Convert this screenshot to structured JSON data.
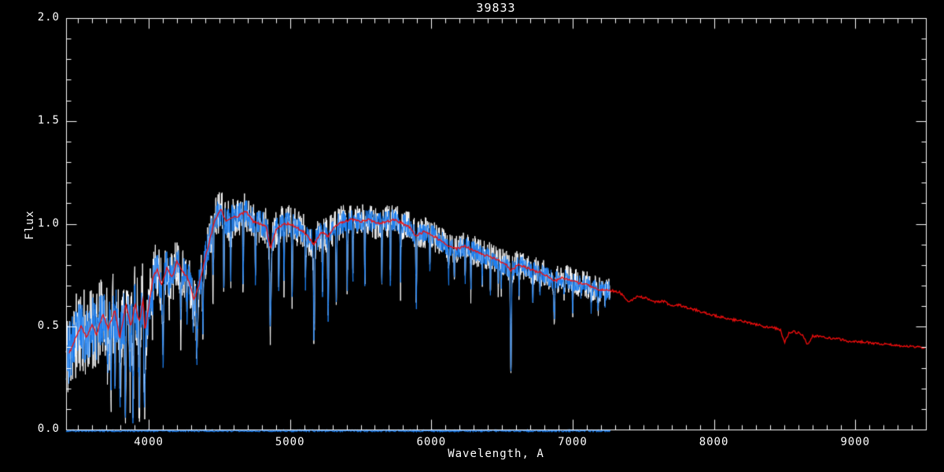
{
  "window": {
    "background": "#000000"
  },
  "chart_data": {
    "type": "line",
    "title": "39833",
    "xlabel": "Wavelength, A",
    "ylabel": "Flux",
    "xlim": [
      3415,
      9500
    ],
    "ylim": [
      0.0,
      2.0
    ],
    "grid": false,
    "legend": "none",
    "axis_color": "#FFFFFF",
    "background": "#000000",
    "x_ticks": [
      4000,
      5000,
      6000,
      7000,
      8000,
      9000
    ],
    "x_tick_labels": [
      "4000",
      "5000",
      "6000",
      "7000",
      "8000",
      "9000"
    ],
    "x_minor_step": 100,
    "y_ticks": [
      0.0,
      0.5,
      1.0,
      1.5,
      2.0
    ],
    "y_tick_labels": [
      "0.0",
      "0.5",
      "1.0",
      "1.5",
      "2.0"
    ],
    "y_minor_step": 0.1,
    "series": [
      {
        "name": "observed-spectrum",
        "color": "#FFFFFF",
        "kind": "noisy",
        "x_range": [
          3415,
          7265
        ],
        "step": 2.2,
        "noise_scale": 1.5,
        "line_depth_scale": 1.0,
        "seed": 11,
        "line_width": 1
      },
      {
        "name": "fitted-spectrum",
        "color": "#1D7FF0",
        "kind": "noisy",
        "x_range": [
          3415,
          7265
        ],
        "step": 2.2,
        "noise_scale": 1.0,
        "line_depth_scale": 1.0,
        "seed": 23,
        "line_width": 1
      },
      {
        "name": "template-spectrum",
        "color": "#F40D0D",
        "kind": "smooth",
        "x_range": [
          3437,
          9500
        ],
        "step": 6,
        "jitter": 0.006,
        "seed": 37,
        "line_width": 1.3
      },
      {
        "name": "error-spectrum",
        "color": "#1D7FF0",
        "kind": "flat",
        "x_range": [
          3415,
          7265
        ],
        "step": 5,
        "level": -0.006,
        "jitter": 0.004,
        "seed": 51,
        "line_width": 1.5
      }
    ],
    "continuum_points": [
      [
        3437,
        0.37
      ],
      [
        3480,
        0.44
      ],
      [
        3520,
        0.5
      ],
      [
        3560,
        0.45
      ],
      [
        3600,
        0.51
      ],
      [
        3630,
        0.46
      ],
      [
        3675,
        0.56
      ],
      [
        3715,
        0.49
      ],
      [
        3760,
        0.58
      ],
      [
        3795,
        0.44
      ],
      [
        3838,
        0.61
      ],
      [
        3872,
        0.5
      ],
      [
        3905,
        0.61
      ],
      [
        3933,
        0.52
      ],
      [
        3961,
        0.64
      ],
      [
        3972,
        0.48
      ],
      [
        3990,
        0.55
      ],
      [
        4030,
        0.74
      ],
      [
        4060,
        0.78
      ],
      [
        4090,
        0.7
      ],
      [
        4130,
        0.79
      ],
      [
        4165,
        0.74
      ],
      [
        4200,
        0.82
      ],
      [
        4240,
        0.77
      ],
      [
        4280,
        0.73
      ],
      [
        4320,
        0.63
      ],
      [
        4355,
        0.7
      ],
      [
        4395,
        0.82
      ],
      [
        4435,
        0.93
      ],
      [
        4470,
        1.02
      ],
      [
        4510,
        1.07
      ],
      [
        4550,
        1.01
      ],
      [
        4590,
        1.03
      ],
      [
        4640,
        1.04
      ],
      [
        4690,
        1.06
      ],
      [
        4740,
        1.01
      ],
      [
        4790,
        1.0
      ],
      [
        4830,
        0.99
      ],
      [
        4861,
        0.88
      ],
      [
        4900,
        0.97
      ],
      [
        4950,
        1.0
      ],
      [
        5000,
        1.0
      ],
      [
        5050,
        0.98
      ],
      [
        5100,
        0.96
      ],
      [
        5170,
        0.9
      ],
      [
        5220,
        0.96
      ],
      [
        5270,
        0.94
      ],
      [
        5320,
        0.99
      ],
      [
        5380,
        1.01
      ],
      [
        5440,
        1.02
      ],
      [
        5500,
        1.01
      ],
      [
        5560,
        1.02
      ],
      [
        5620,
        1.0
      ],
      [
        5680,
        1.01
      ],
      [
        5740,
        1.02
      ],
      [
        5800,
        1.0
      ],
      [
        5850,
        0.98
      ],
      [
        5893,
        0.94
      ],
      [
        5940,
        0.96
      ],
      [
        6000,
        0.95
      ],
      [
        6060,
        0.92
      ],
      [
        6120,
        0.89
      ],
      [
        6180,
        0.88
      ],
      [
        6240,
        0.89
      ],
      [
        6300,
        0.87
      ],
      [
        6360,
        0.85
      ],
      [
        6420,
        0.84
      ],
      [
        6480,
        0.82
      ],
      [
        6530,
        0.8
      ],
      [
        6563,
        0.77
      ],
      [
        6610,
        0.8
      ],
      [
        6670,
        0.79
      ],
      [
        6730,
        0.77
      ],
      [
        6790,
        0.76
      ],
      [
        6870,
        0.72
      ],
      [
        6930,
        0.74
      ],
      [
        7000,
        0.72
      ],
      [
        7060,
        0.71
      ],
      [
        7120,
        0.7
      ],
      [
        7190,
        0.68
      ],
      [
        7265,
        0.675
      ],
      [
        7330,
        0.67
      ],
      [
        7400,
        0.62
      ],
      [
        7460,
        0.645
      ],
      [
        7520,
        0.64
      ],
      [
        7580,
        0.62
      ],
      [
        7640,
        0.625
      ],
      [
        7700,
        0.6
      ],
      [
        7760,
        0.605
      ],
      [
        7820,
        0.59
      ],
      [
        7880,
        0.58
      ],
      [
        7940,
        0.565
      ],
      [
        8000,
        0.555
      ],
      [
        8060,
        0.545
      ],
      [
        8120,
        0.535
      ],
      [
        8180,
        0.53
      ],
      [
        8240,
        0.52
      ],
      [
        8300,
        0.51
      ],
      [
        8360,
        0.5
      ],
      [
        8420,
        0.495
      ],
      [
        8470,
        0.485
      ],
      [
        8500,
        0.425
      ],
      [
        8530,
        0.47
      ],
      [
        8570,
        0.475
      ],
      [
        8620,
        0.465
      ],
      [
        8662,
        0.415
      ],
      [
        8700,
        0.455
      ],
      [
        8760,
        0.45
      ],
      [
        8820,
        0.445
      ],
      [
        8880,
        0.44
      ],
      [
        8940,
        0.43
      ],
      [
        9000,
        0.43
      ],
      [
        9060,
        0.425
      ],
      [
        9120,
        0.42
      ],
      [
        9200,
        0.415
      ],
      [
        9280,
        0.41
      ],
      [
        9360,
        0.405
      ],
      [
        9440,
        0.4
      ],
      [
        9500,
        0.395
      ]
    ],
    "absorption_lines": [
      [
        3712,
        0.3,
        7
      ],
      [
        3734,
        0.26,
        6
      ],
      [
        3760,
        0.3,
        6
      ],
      [
        3798,
        0.22,
        7
      ],
      [
        3835,
        0.13,
        8
      ],
      [
        3868,
        0.28,
        6
      ],
      [
        3889,
        0.14,
        8
      ],
      [
        3933,
        0.11,
        9
      ],
      [
        3970,
        0.1,
        10
      ],
      [
        4026,
        0.55,
        6
      ],
      [
        4101,
        0.33,
        10
      ],
      [
        4144,
        0.62,
        6
      ],
      [
        4226,
        0.5,
        7
      ],
      [
        4271,
        0.56,
        6
      ],
      [
        4315,
        0.52,
        7
      ],
      [
        4340,
        0.36,
        10
      ],
      [
        4383,
        0.48,
        7
      ],
      [
        4455,
        0.68,
        6
      ],
      [
        4531,
        0.7,
        6
      ],
      [
        4580,
        0.74,
        6
      ],
      [
        4668,
        0.72,
        6
      ],
      [
        4755,
        0.7,
        6
      ],
      [
        4861,
        0.47,
        10
      ],
      [
        4920,
        0.68,
        6
      ],
      [
        4957,
        0.7,
        6
      ],
      [
        5015,
        0.66,
        6
      ],
      [
        5110,
        0.7,
        6
      ],
      [
        5170,
        0.45,
        9
      ],
      [
        5230,
        0.68,
        6
      ],
      [
        5270,
        0.55,
        7
      ],
      [
        5328,
        0.63,
        6
      ],
      [
        5405,
        0.67,
        6
      ],
      [
        5445,
        0.72,
        5
      ],
      [
        5530,
        0.7,
        6
      ],
      [
        5650,
        0.74,
        5
      ],
      [
        5710,
        0.72,
        6
      ],
      [
        5782,
        0.7,
        5
      ],
      [
        5893,
        0.6,
        7
      ],
      [
        5990,
        0.72,
        5
      ],
      [
        6122,
        0.7,
        5
      ],
      [
        6162,
        0.7,
        5
      ],
      [
        6240,
        0.72,
        5
      ],
      [
        6280,
        0.68,
        5
      ],
      [
        6360,
        0.72,
        5
      ],
      [
        6418,
        0.68,
        5
      ],
      [
        6473,
        0.7,
        5
      ],
      [
        6495,
        0.68,
        5
      ],
      [
        6563,
        0.28,
        8
      ],
      [
        6620,
        0.68,
        5
      ],
      [
        6717,
        0.6,
        6
      ],
      [
        6770,
        0.66,
        5
      ],
      [
        6870,
        0.56,
        8
      ],
      [
        6940,
        0.64,
        5
      ],
      [
        7000,
        0.6,
        6
      ],
      [
        7060,
        0.63,
        5
      ],
      [
        7130,
        0.6,
        6
      ],
      [
        7180,
        0.58,
        7
      ],
      [
        7230,
        0.62,
        5
      ]
    ],
    "noise_profile": [
      [
        3415,
        0.15
      ],
      [
        3600,
        0.14
      ],
      [
        3800,
        0.14
      ],
      [
        3960,
        0.13
      ],
      [
        4020,
        0.1
      ],
      [
        4200,
        0.085
      ],
      [
        4400,
        0.075
      ],
      [
        4700,
        0.065
      ],
      [
        5000,
        0.06
      ],
      [
        5500,
        0.055
      ],
      [
        6000,
        0.05
      ],
      [
        6500,
        0.048
      ],
      [
        7000,
        0.045
      ],
      [
        7265,
        0.045
      ]
    ]
  }
}
